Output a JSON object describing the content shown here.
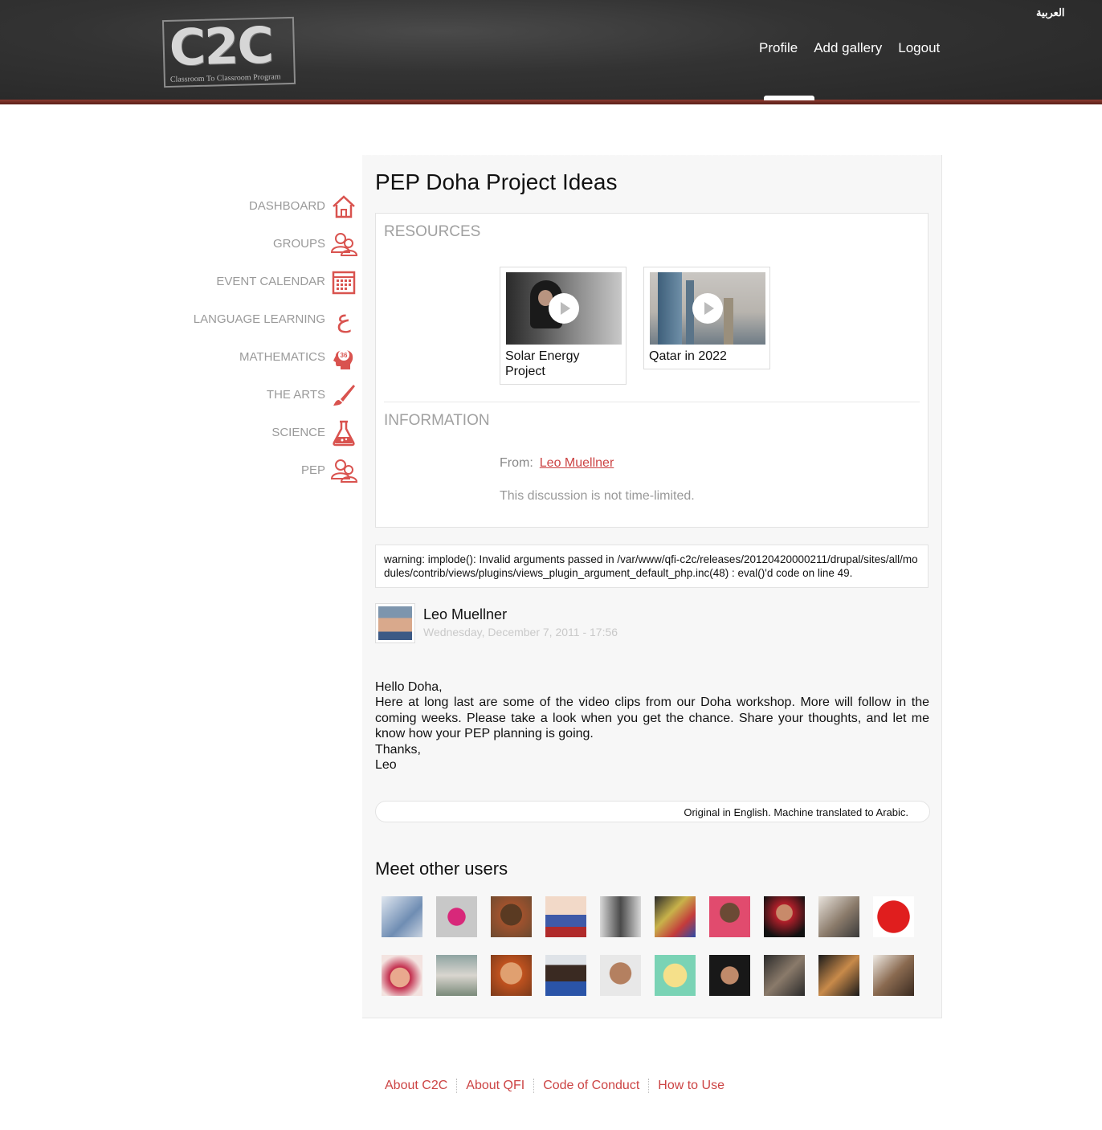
{
  "header": {
    "logo_text": "C2C",
    "logo_subtitle": "Classroom To Classroom Program",
    "lang_link": "العربية",
    "nav": [
      "Profile",
      "Add gallery",
      "Logout"
    ]
  },
  "sidebar": {
    "items": [
      {
        "label": "DASHBOARD",
        "icon": "home-icon"
      },
      {
        "label": "GROUPS",
        "icon": "users-icon"
      },
      {
        "label": "EVENT CALENDAR",
        "icon": "calendar-icon"
      },
      {
        "label": "LANGUAGE LEARNING",
        "icon": "arabic-letter-icon"
      },
      {
        "label": "MATHEMATICS",
        "icon": "head-36-icon"
      },
      {
        "label": "THE ARTS",
        "icon": "brush-icon"
      },
      {
        "label": "SCIENCE",
        "icon": "flask-icon"
      },
      {
        "label": "PEP",
        "icon": "users-icon"
      }
    ]
  },
  "page": {
    "title": "PEP Doha Project Ideas",
    "resources_heading": "RESOURCES",
    "resources": [
      {
        "caption": "Solar Energy Project"
      },
      {
        "caption": "Qatar in 2022"
      }
    ],
    "information_heading": "INFORMATION",
    "from_label": "From:",
    "from_name": "Leo Muellner",
    "time_note": "This discussion is not time-limited.",
    "warning": "warning: implode(): Invalid arguments passed in /var/www/qfi-c2c/releases/20120420000211/drupal/sites/all/modules/contrib/views/plugins/views_plugin_argument_default_php.inc(48) : eval()'d code on line 49.",
    "author": "Leo Muellner",
    "date": "Wednesday, December 7, 2011 - 17:56",
    "message_lines": [
      "Hello Doha,",
      "Here at long last are some of the video clips from our Doha workshop. More will follow in the coming weeks. Please take a look when you get the chance. Share your thoughts, and let me know how your PEP planning is going.",
      "Thanks,",
      "Leo"
    ],
    "translation_note": "Original in English. Machine translated to Arabic.",
    "meet_title": "Meet other users"
  },
  "footer": {
    "links": [
      "About C2C",
      "About QFI",
      "Code of Conduct",
      "How to Use"
    ]
  },
  "colors": {
    "accent": "#cc4444",
    "header_bg": "#333333",
    "panel_bg": "#f7f7f7"
  }
}
